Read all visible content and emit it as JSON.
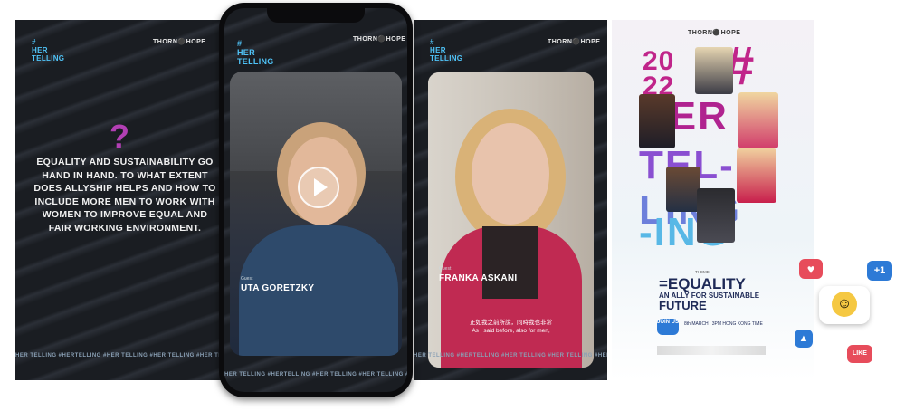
{
  "brand": {
    "hashtag": "#",
    "her": "HER",
    "telling": "TELLING",
    "partner": "THORN⚫HOPE"
  },
  "ticker": "HER TELLING #HERTELLING #HER TELLING #HER TELLING #HER TELLING #HER",
  "quote_panel": {
    "symbol": "?",
    "text": "EQUALITY AND SUSTAINABILITY GO HAND IN HAND. TO WHAT EXTENT DOES ALLYSHIP HELPS AND HOW TO INCLUDE MORE MEN TO WORK WITH WOMEN TO IMPROVE EQUAL AND FAIR WORKING ENVIRONMENT."
  },
  "phone_video": {
    "guest_label": "Guest",
    "guest_name": "UTA GORETZKY"
  },
  "second_video": {
    "guest_label": "Guest",
    "guest_name": "FRANKA ASKANI",
    "caption_cn": "正如我之前所說，同時我也非常",
    "caption_en": "As I said before, also for men,"
  },
  "poster": {
    "partner": "THORN⚫HOPE",
    "year_top": "20",
    "year_bottom": "22",
    "line1": "#",
    "line2": "HER",
    "line3": "TEL-",
    "line4": "LING",
    "line5": "-ING",
    "theme_label": "THEME",
    "theme_title": "=EQUALITY",
    "theme_sub": "AN ALLY FOR SUSTAINABLE",
    "theme_sub2": "FUTURE",
    "join": "JOIN US",
    "event_line": "8th MARCH | 3PM  HONG KONG TIME"
  },
  "reactions": {
    "heart": "heart-reaction",
    "plus_one": "+1",
    "like_label": "LIKE"
  },
  "colors": {
    "magenta": "#c0258a",
    "cyan": "#4fc3f7",
    "navy": "#1e2a57",
    "heart_red": "#e74c5b",
    "blue": "#2d7ad6"
  }
}
